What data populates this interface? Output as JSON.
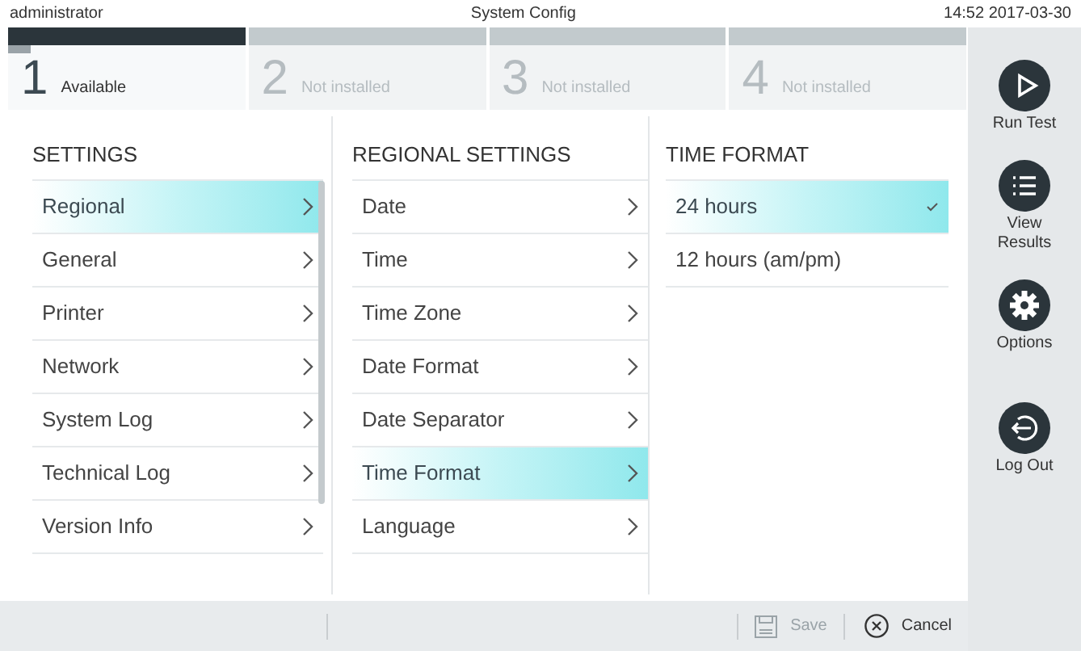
{
  "top_bar": {
    "user": "administrator",
    "title": "System Config",
    "datetime": "14:52 2017-03-30"
  },
  "modules": [
    {
      "number": "1",
      "status": "Available",
      "selected": true
    },
    {
      "number": "2",
      "status": "Not installed",
      "selected": false
    },
    {
      "number": "3",
      "status": "Not installed",
      "selected": false
    },
    {
      "number": "4",
      "status": "Not installed",
      "selected": false
    }
  ],
  "settings": {
    "heading": "SETTINGS",
    "items": [
      {
        "label": "Regional",
        "selected": true
      },
      {
        "label": "General",
        "selected": false
      },
      {
        "label": "Printer",
        "selected": false
      },
      {
        "label": "Network",
        "selected": false
      },
      {
        "label": "System Log",
        "selected": false
      },
      {
        "label": "Technical Log",
        "selected": false
      },
      {
        "label": "Version Info",
        "selected": false
      }
    ]
  },
  "regional_settings": {
    "heading": "REGIONAL SETTINGS",
    "items": [
      {
        "label": "Date",
        "selected": false
      },
      {
        "label": "Time",
        "selected": false
      },
      {
        "label": "Time Zone",
        "selected": false
      },
      {
        "label": "Date Format",
        "selected": false
      },
      {
        "label": "Date Separator",
        "selected": false
      },
      {
        "label": "Time Format",
        "selected": true
      },
      {
        "label": "Language",
        "selected": false
      }
    ]
  },
  "time_format": {
    "heading": "TIME FORMAT",
    "options": [
      {
        "label": "24 hours",
        "selected": true
      },
      {
        "label": "12 hours (am/pm)",
        "selected": false
      }
    ]
  },
  "footer": {
    "save": {
      "label": "Save",
      "disabled": true
    },
    "cancel": {
      "label": "Cancel"
    }
  },
  "sidebar": [
    {
      "kind": "run",
      "label": "Run Test"
    },
    {
      "kind": "results",
      "label": "View Results"
    },
    {
      "kind": "options",
      "label": "Options"
    },
    {
      "kind": "logout",
      "label": "Log Out"
    }
  ]
}
